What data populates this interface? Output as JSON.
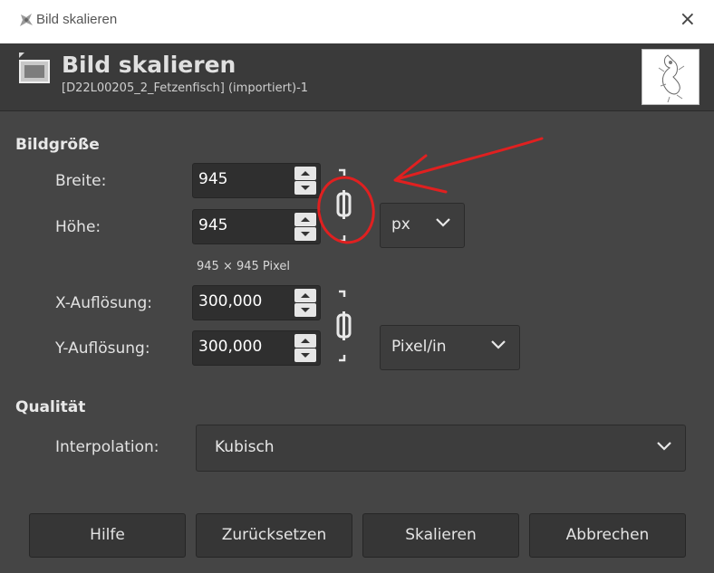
{
  "window": {
    "title": "Bild skalieren",
    "close_glyph": "×"
  },
  "header": {
    "title": "Bild skalieren",
    "subtitle": "[D22L00205_2_Fetzenfisch] (importiert)-1"
  },
  "image_size": {
    "section_label": "Bildgröße",
    "width_label": "Breite:",
    "width_value": "945",
    "height_label": "Höhe:",
    "height_value": "945",
    "unit": "px",
    "pixel_info": "945 × 945 Pixel",
    "xres_label": "X-Auflösung:",
    "xres_value": "300,000",
    "yres_label": "Y-Auflösung:",
    "yres_value": "300,000",
    "res_unit": "Pixel/in"
  },
  "quality": {
    "section_label": "Qualität",
    "interpolation_label": "Interpolation:",
    "interpolation_value": "Kubisch"
  },
  "buttons": {
    "help": "Hilfe",
    "reset": "Zurücksetzen",
    "scale": "Skalieren",
    "cancel": "Abbrechen"
  },
  "colors": {
    "annotation": "#e02020",
    "background": "#454545"
  },
  "icons": [
    "app-icon",
    "close-icon",
    "image-icon",
    "chain-link-icon",
    "chevron-down-icon",
    "spin-up-icon",
    "spin-down-icon"
  ]
}
